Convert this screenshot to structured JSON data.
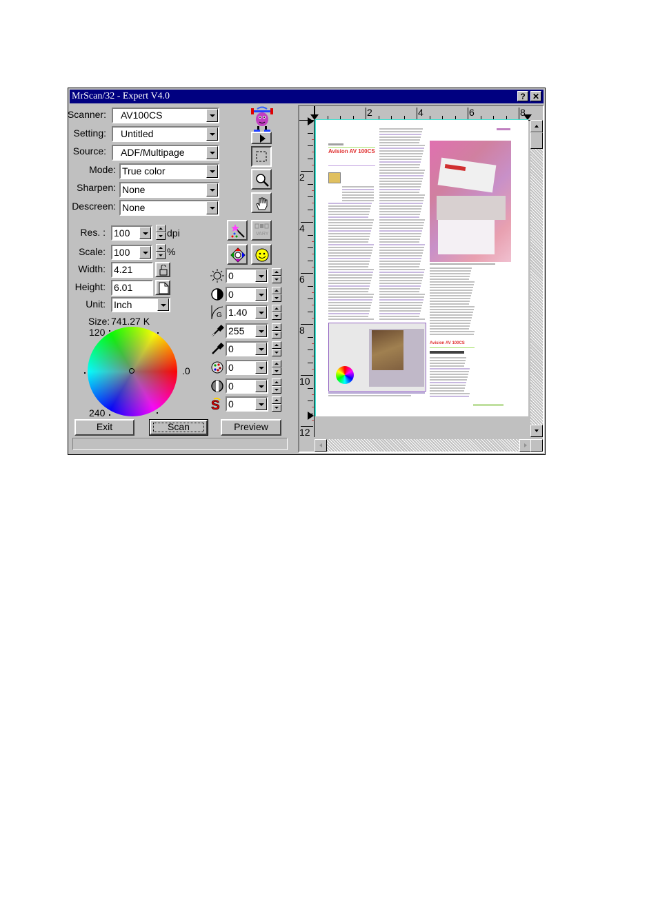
{
  "window": {
    "title": "MrScan/32 - Expert V4.0",
    "help_button": "?",
    "close_button": "✕"
  },
  "settings": {
    "scanner": {
      "label": "Scanner:",
      "value": "AV100CS"
    },
    "setting": {
      "label": "Setting:",
      "value": "Untitled"
    },
    "source": {
      "label": "Source:",
      "value": "ADF/Multipage"
    },
    "mode": {
      "label": "Mode:",
      "value": "True color"
    },
    "sharpen": {
      "label": "Sharpen:",
      "value": "None"
    },
    "descreen": {
      "label": "Descreen:",
      "value": "None"
    }
  },
  "dimensions": {
    "res": {
      "label": "Res. :",
      "value": "100",
      "unit": "dpi"
    },
    "scale": {
      "label": "Scale:",
      "value": "100",
      "unit": "%"
    },
    "width": {
      "label": "Width:",
      "value": "4.21"
    },
    "height": {
      "label": "Height:",
      "value": "6.01"
    },
    "unit": {
      "label": "Unit:",
      "value": "Inch"
    },
    "size": {
      "label": "Size:",
      "value": "741.27  K"
    }
  },
  "color_wheel": {
    "label_120": "120",
    "label_0": "0",
    "label_240": "240"
  },
  "tools": [
    {
      "name": "mascot-icon"
    },
    {
      "name": "play-icon"
    },
    {
      "name": "select-rect-icon",
      "pressed": true
    },
    {
      "name": "zoom-icon"
    },
    {
      "name": "hand-pan-icon"
    }
  ],
  "adjustments": [
    {
      "name": "brightness",
      "icon": "brightness-icon",
      "value": "0"
    },
    {
      "name": "contrast",
      "icon": "contrast-icon",
      "value": "0"
    },
    {
      "name": "gamma",
      "icon": "gamma-icon",
      "value": "1.40"
    },
    {
      "name": "highlight",
      "icon": "highlight-eyedropper-icon",
      "value": "255"
    },
    {
      "name": "shadow",
      "icon": "shadow-eyedropper-icon",
      "value": "0"
    },
    {
      "name": "color-balance",
      "icon": "color-palette-icon",
      "value": "0"
    },
    {
      "name": "midtone",
      "icon": "midtone-icon",
      "value": "0"
    },
    {
      "name": "saturation",
      "icon": "saturation-icon",
      "value": "0"
    }
  ],
  "buttons": {
    "exit": "Exit",
    "scan": "Scan",
    "preview": "Preview"
  },
  "ruler": {
    "horizontal": [
      "2",
      "4",
      "6",
      "8"
    ],
    "vertical": [
      "2",
      "4",
      "6",
      "8",
      "10",
      "12"
    ]
  },
  "preview_doc": {
    "heading": "Avision AV 100CS",
    "subheading": "Avision AV 100CS"
  }
}
